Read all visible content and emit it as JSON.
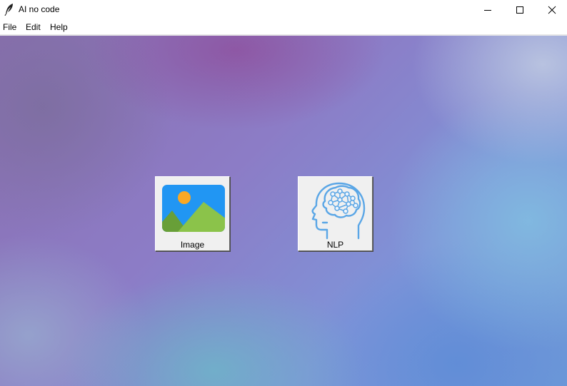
{
  "window": {
    "title": "AI no code",
    "controls": {
      "minimize_icon": "minimize-icon",
      "maximize_icon": "maximize-icon",
      "close_icon": "close-icon"
    }
  },
  "menubar": {
    "items": [
      {
        "label": "File"
      },
      {
        "label": "Edit"
      },
      {
        "label": "Help"
      }
    ]
  },
  "tiles": [
    {
      "label": "Image",
      "icon": "landscape-image-icon"
    },
    {
      "label": "NLP",
      "icon": "brain-head-icon"
    }
  ],
  "colors": {
    "image_icon_sky": "#2196f3",
    "image_icon_sun": "#f9a825",
    "image_icon_hill_dark": "#689f38",
    "image_icon_hill_light": "#8bc34a",
    "nlp_icon_stroke": "#5aa6e6",
    "tile_face": "#f0f0f0"
  }
}
